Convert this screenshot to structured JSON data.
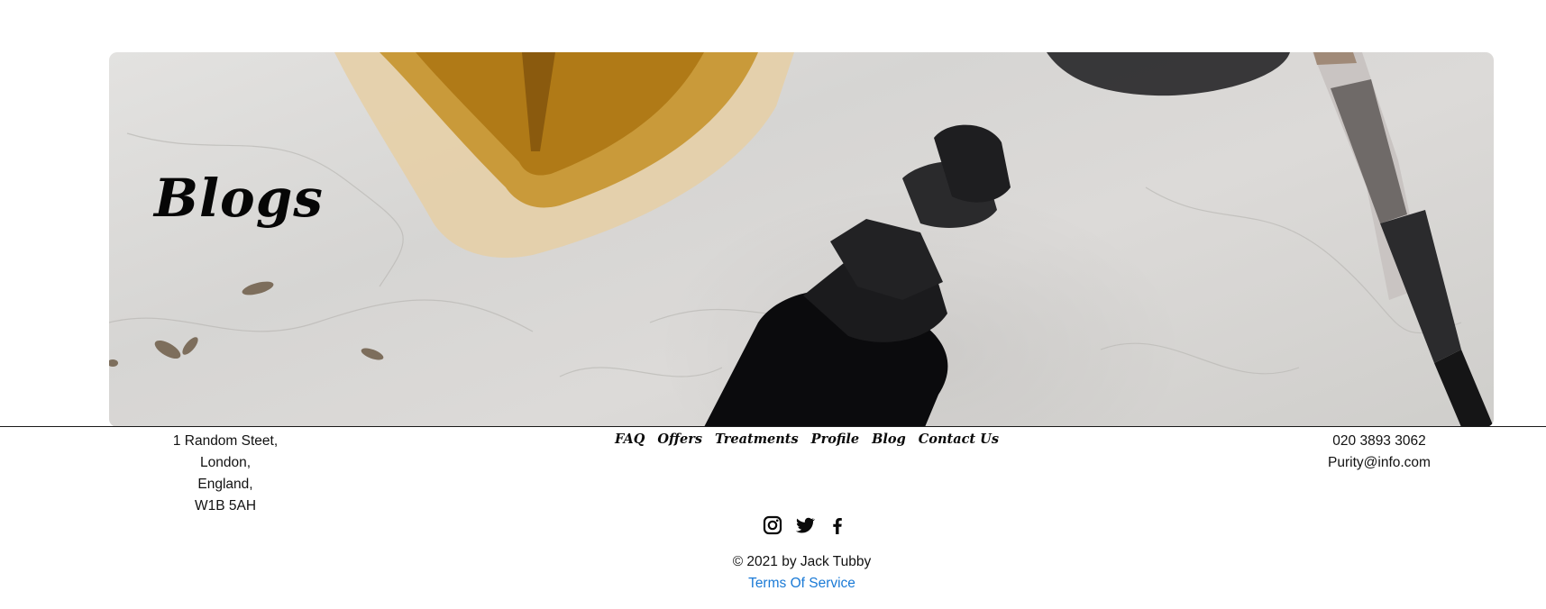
{
  "hero": {
    "title": "Blogs"
  },
  "footer": {
    "address": [
      "1 Random Steet,",
      "London,",
      "England,",
      "W1B 5AH"
    ],
    "nav": [
      {
        "label": "FAQ"
      },
      {
        "label": "Offers"
      },
      {
        "label": "Treatments"
      },
      {
        "label": "Profile"
      },
      {
        "label": "Blog"
      },
      {
        "label": "Contact Us"
      }
    ],
    "contact": {
      "phone": "020 3893 3062",
      "email": "Purity@info.com"
    },
    "social": [
      "instagram-icon",
      "twitter-icon",
      "facebook-icon"
    ],
    "copyright": "© 2021 by Jack Tubby",
    "terms_label": "Terms Of Service"
  },
  "colors": {
    "link": "#1a7ad6",
    "text": "#111111",
    "background": "#ffffff"
  }
}
